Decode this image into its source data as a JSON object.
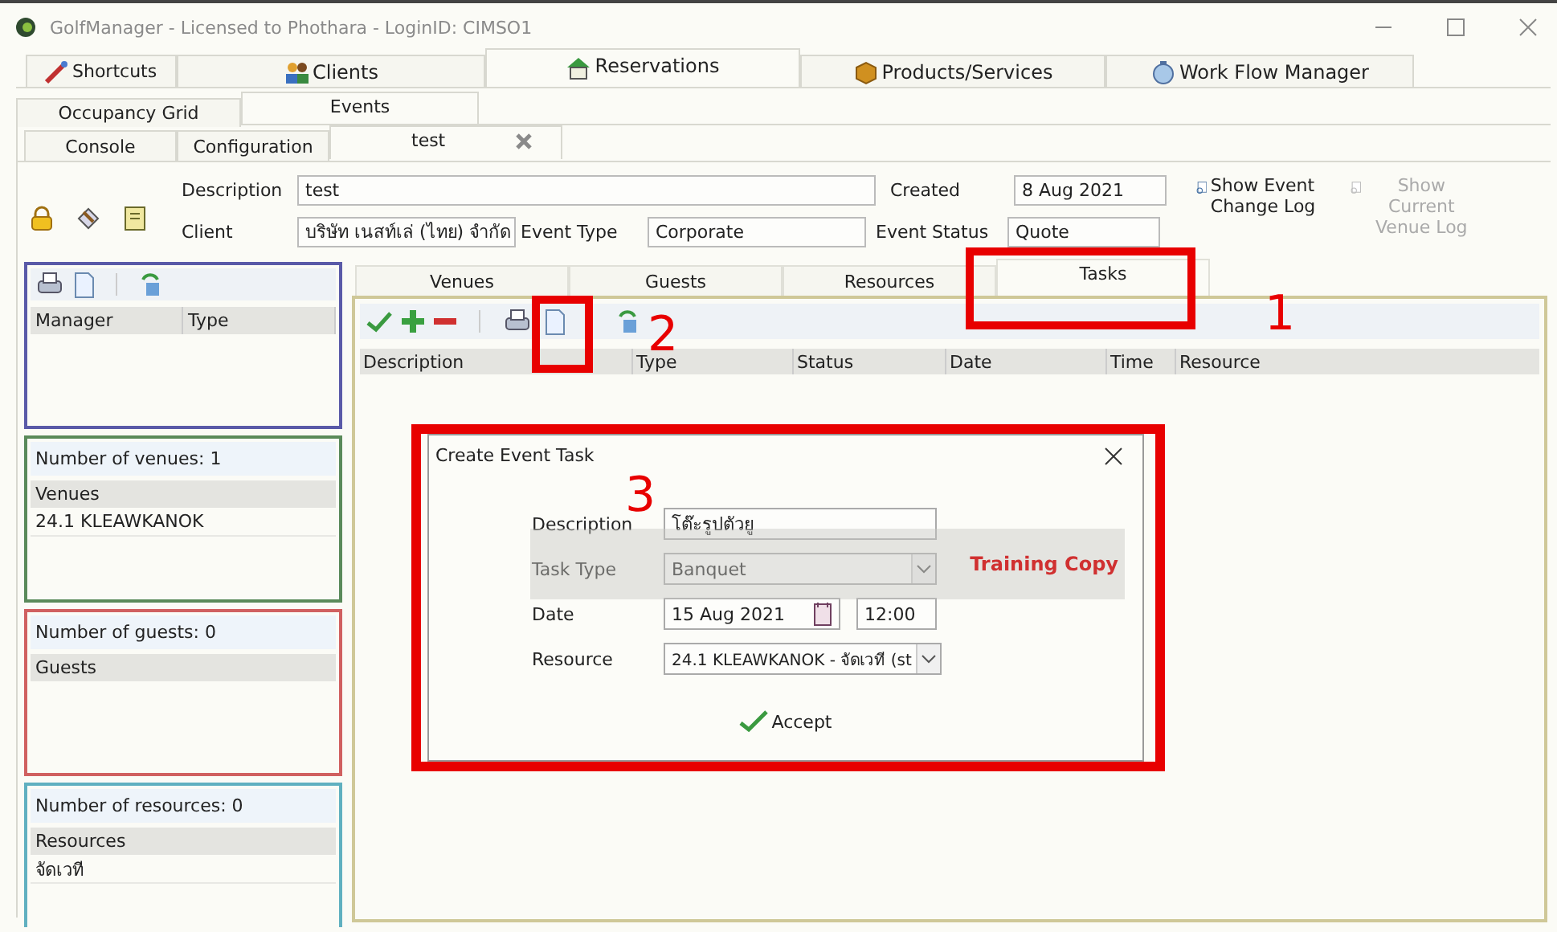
{
  "window": {
    "title": "GolfManager - Licensed to Phothara - LoginID: CIMSO1"
  },
  "main_tabs": [
    {
      "label": "Shortcuts",
      "selected": false
    },
    {
      "label": "Clients",
      "selected": false
    },
    {
      "label": "Reservations",
      "selected": true
    },
    {
      "label": "Products/Services",
      "selected": false
    },
    {
      "label": "Work Flow Manager",
      "selected": false
    }
  ],
  "sub_tabs": [
    {
      "label": "Occupancy Grid",
      "selected": false
    },
    {
      "label": "Events",
      "selected": true
    }
  ],
  "doc_tabs": [
    {
      "label": "Console",
      "selected": false,
      "closable": false
    },
    {
      "label": "Configuration",
      "selected": false,
      "closable": false
    },
    {
      "label": "test",
      "selected": true,
      "closable": true
    }
  ],
  "event": {
    "fields": [
      {
        "label": "Description",
        "value": "test"
      },
      {
        "label": "Client",
        "value": "บริษัท เนสท์เล่ (ไทย) จำกัด"
      },
      {
        "label": "Event Type",
        "value": "Corporate"
      }
    ],
    "side_fields": [
      {
        "label": "Created",
        "value": "8 Aug 2021"
      },
      {
        "label": "Event Status",
        "value": "Quote"
      }
    ],
    "links": [
      {
        "label": "Show Event Change Log",
        "disabled": false
      },
      {
        "label": "Show Current Venue Log",
        "disabled": true
      }
    ]
  },
  "manager_panel": {
    "columns": [
      "Manager",
      "Type"
    ]
  },
  "panels": [
    {
      "count": "Number of venues: 1",
      "heading": "Venues",
      "rows": [
        "24.1 KLEAWKANOK"
      ],
      "color": "#5a8a5a"
    },
    {
      "count": "Number of guests: 0",
      "heading": "Guests",
      "color": "#d06060"
    },
    {
      "count": "Number of resources: 0",
      "heading": "Resources",
      "rows": [
        "จัดเวที"
      ],
      "color": "#60b0c0"
    }
  ],
  "detail_tabs": [
    {
      "label": "Venues",
      "selected": false
    },
    {
      "label": "Guests",
      "selected": false
    },
    {
      "label": "Resources",
      "selected": false
    },
    {
      "label": "Tasks",
      "selected": true
    }
  ],
  "task_columns": [
    "Description",
    "Type",
    "Status",
    "Date",
    "Time",
    "Resource"
  ],
  "dialog": {
    "title": "Create Event Task",
    "fields": [
      {
        "kind": "text",
        "label": "Description",
        "value": "โต๊ะรูปตัวยู"
      },
      {
        "kind": "select",
        "label": "Task Type",
        "value": "Banquet"
      },
      {
        "kind": "date",
        "label": "Date",
        "value": "15 Aug 2021",
        "time": "12:00"
      },
      {
        "kind": "select",
        "label": "Resource",
        "value": "24.1 KLEAWKANOK - จัดเวที (st"
      }
    ],
    "accept": "Accept",
    "watermark": "Training Copy"
  },
  "annotations": [
    "1",
    "2",
    "3"
  ]
}
